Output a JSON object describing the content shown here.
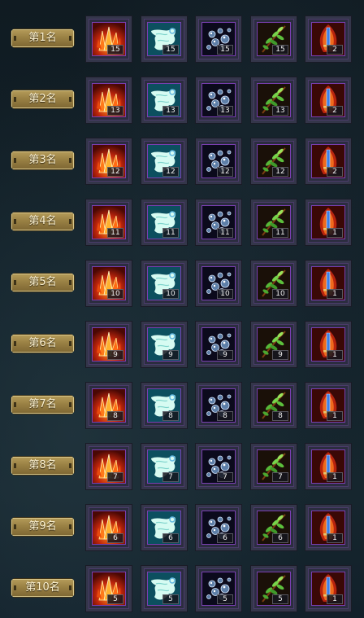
{
  "columns": [
    {
      "icon": "fire-crystal-icon"
    },
    {
      "icon": "spirit-wing-icon"
    },
    {
      "icon": "bubble-orbs-icon"
    },
    {
      "icon": "green-leaf-icon"
    },
    {
      "icon": "flame-sword-icon"
    }
  ],
  "rows": [
    {
      "rank_label": "第1名",
      "counts": [
        "15",
        "15",
        "15",
        "15",
        "2"
      ]
    },
    {
      "rank_label": "第2名",
      "counts": [
        "13",
        "13",
        "13",
        "13",
        "2"
      ]
    },
    {
      "rank_label": "第3名",
      "counts": [
        "12",
        "12",
        "12",
        "12",
        "2"
      ]
    },
    {
      "rank_label": "第4名",
      "counts": [
        "11",
        "11",
        "11",
        "11",
        "1"
      ]
    },
    {
      "rank_label": "第5名",
      "counts": [
        "10",
        "10",
        "10",
        "10",
        "1"
      ]
    },
    {
      "rank_label": "第6名",
      "counts": [
        "9",
        "9",
        "9",
        "9",
        "1"
      ]
    },
    {
      "rank_label": "第7名",
      "counts": [
        "8",
        "8",
        "8",
        "8",
        "1"
      ]
    },
    {
      "rank_label": "第8名",
      "counts": [
        "7",
        "7",
        "7",
        "7",
        "1"
      ]
    },
    {
      "rank_label": "第9名",
      "counts": [
        "6",
        "6",
        "6",
        "6",
        "1"
      ]
    },
    {
      "rank_label": "第10名",
      "counts": [
        "5",
        "5",
        "5",
        "5",
        "1"
      ]
    }
  ],
  "colors": {
    "rank_badge": "#9a8144",
    "slot_frame": "#34364a",
    "slot_border": "#7a3fb2"
  }
}
